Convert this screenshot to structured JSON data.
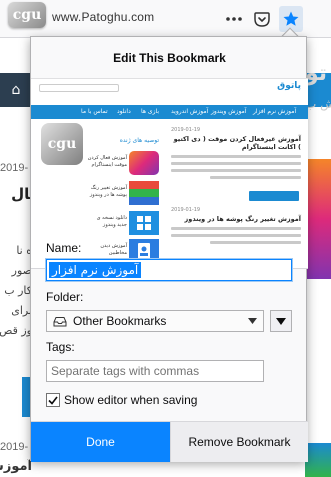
{
  "browser": {
    "site_logo_text": "cgu",
    "url_text": "www.Patoghu.com",
    "icons": [
      "more-dots-icon",
      "pocket-icon",
      "bookmark-star-icon"
    ]
  },
  "background_page": {
    "date_1": "2019-",
    "heading_1": "عال",
    "lines": [
      "ه نا",
      "صور",
      "کار ب",
      "برای",
      "وز قص"
    ],
    "date_2": "2019-",
    "heading_2": "آموزش تغی",
    "right_title": "تو",
    "right_sub": "ش ب"
  },
  "panel": {
    "title": "Edit This Bookmark",
    "preview": {
      "brand": "پاتوق",
      "logo_text": "cgu",
      "nav_items": [
        "آموزش نرم افزار",
        "آموزش ویندوز",
        "آموزش اندروید",
        "بازی ها",
        "دانلود",
        "تماس با ما"
      ],
      "column_title": "توصیه های ژنده",
      "thumb_labels": [
        "آموزش فعال کردن موقت اینستاگرام",
        "آموزش تغییر رنگ پوشه ها در ویندوز",
        "دانلود نسخه ی جدید ویندوز",
        "آموزش دیدن مخاطبین"
      ],
      "articles": [
        {
          "date": "2019-01-19",
          "title": "آموزش غیرفعال کردن موقت ( دی اکتیو ) اکانت اینستاگرام"
        },
        {
          "date": "2019-01-19",
          "title": "آموزش تغییر رنگ پوشه ها در ویندوز"
        }
      ]
    },
    "name_label": "Name:",
    "name_value": "آموزش نرم افزار",
    "folder_label": "Folder:",
    "folder_value": "Other Bookmarks",
    "tags_label": "Tags:",
    "tags_placeholder": "Separate tags with commas",
    "show_editor_label": "Show editor when saving",
    "show_editor_checked": true,
    "done_label": "Done",
    "remove_label": "Remove Bookmark"
  },
  "colors": {
    "accent": "#0a84ff",
    "site_blue": "#1b8ad1",
    "panel_bg": "#f9f9fa"
  }
}
